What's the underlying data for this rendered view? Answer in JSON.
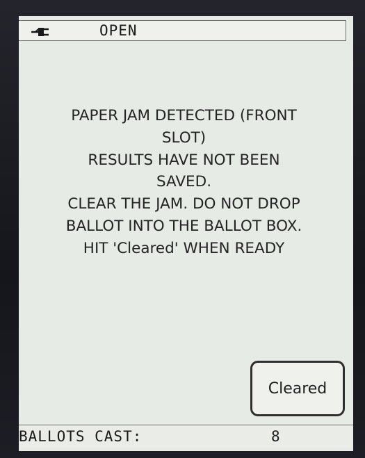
{
  "status_bar": {
    "power_icon": "plug-icon",
    "status_text": "OPEN"
  },
  "message": {
    "lines": [
      "PAPER JAM DETECTED (FRONT",
      "SLOT)",
      "RESULTS HAVE NOT BEEN",
      "SAVED.",
      "CLEAR THE JAM. DO NOT DROP",
      "BALLOT INTO THE BALLOT BOX.",
      "HIT 'Cleared' WHEN READY"
    ]
  },
  "actions": {
    "cleared_label": "Cleared"
  },
  "footer": {
    "ballots_cast_label": "BALLOTS CAST:",
    "ballots_cast_value": "8"
  },
  "colors": {
    "screen_background": "#e6ebe5",
    "text": "#242424",
    "bezel": "#1a1c22"
  }
}
